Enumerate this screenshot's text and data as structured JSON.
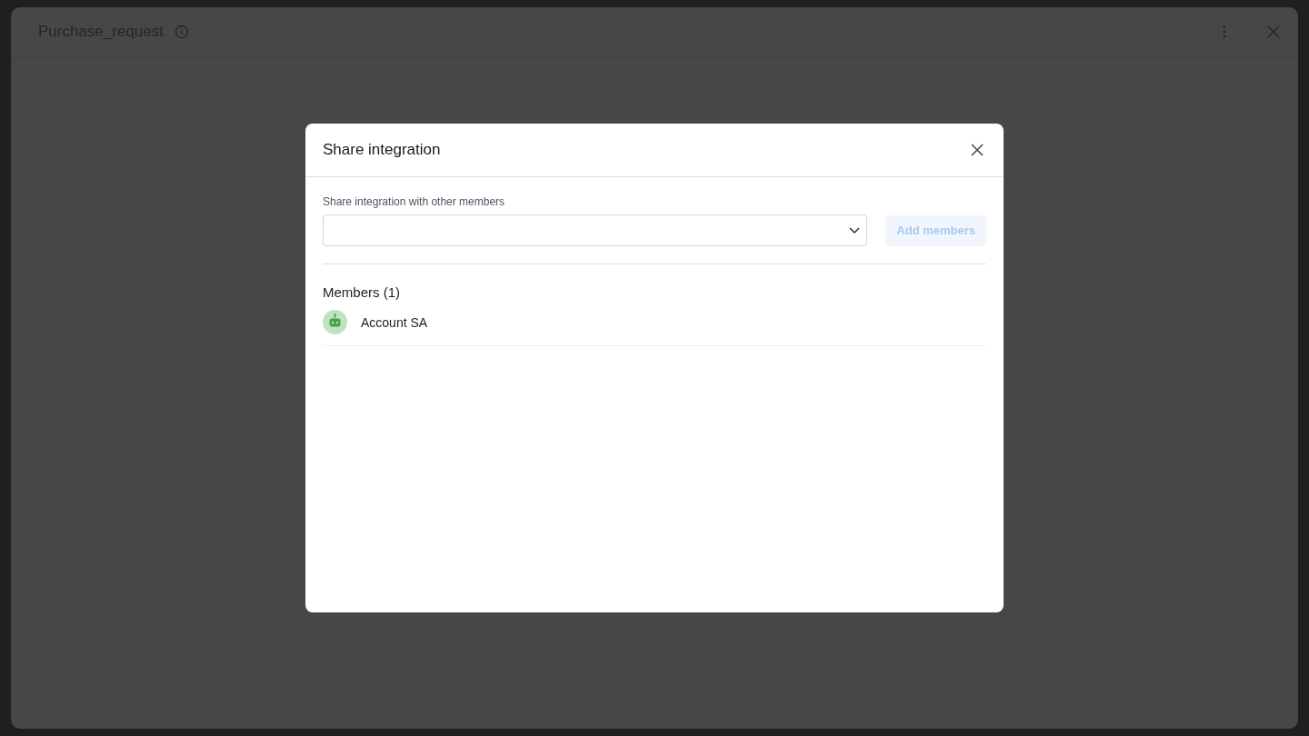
{
  "window": {
    "title": "Purchase_request"
  },
  "dialog": {
    "title": "Share integration",
    "field_label": "Share integration with other members",
    "field": {
      "expanded": false
    },
    "add_button": {
      "label": "Add members",
      "disabled": true
    },
    "members_heading": "Members (1)",
    "members": [
      {
        "name": "Account SA",
        "kind": "bot"
      }
    ]
  }
}
